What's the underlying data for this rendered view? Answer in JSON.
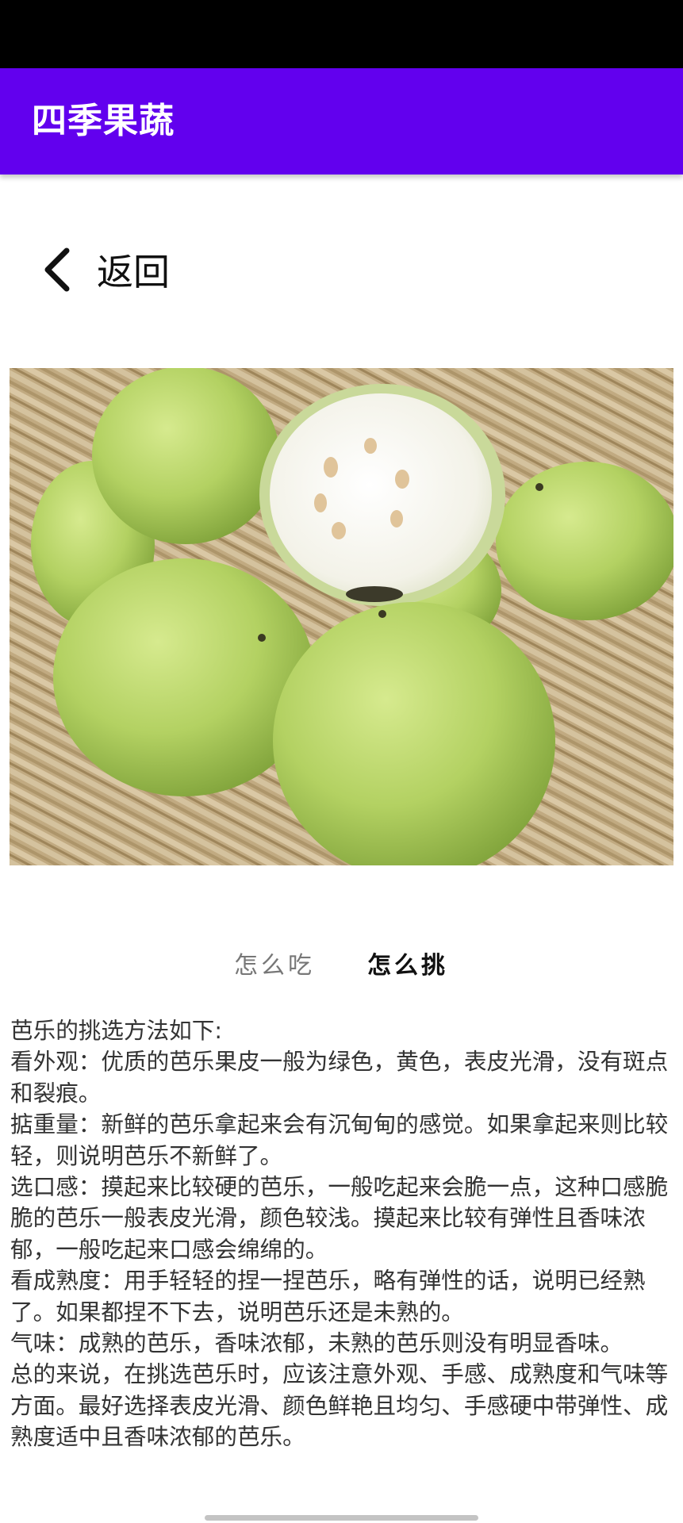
{
  "app": {
    "title": "四季果蔬"
  },
  "nav": {
    "back_label": "返回",
    "back_icon": "chevron-left-icon"
  },
  "hero_image": {
    "subject": "guava-basket-photo"
  },
  "tabs": [
    {
      "label": "怎么吃",
      "selected": false
    },
    {
      "label": "怎么挑",
      "selected": true
    }
  ],
  "content": {
    "paragraphs": [
      "芭乐的挑选方法如下:",
      "看外观：优质的芭乐果皮一般为绿色，黄色，表皮光滑，没有斑点和裂痕。",
      "掂重量：新鲜的芭乐拿起来会有沉甸甸的感觉。如果拿起来则比较轻，则说明芭乐不新鲜了。",
      "选口感：摸起来比较硬的芭乐，一般吃起来会脆一点，这种口感脆脆的芭乐一般表皮光滑，颜色较浅。摸起来比较有弹性且香味浓郁，一般吃起来口感会绵绵的。",
      "看成熟度：用手轻轻的捏一捏芭乐，略有弹性的话，说明已经熟了。如果都捏不下去，说明芭乐还是未熟的。",
      "气味：成熟的芭乐，香味浓郁，未熟的芭乐则没有明显香味。",
      "总的来说，在挑选芭乐时，应该注意外观、手感、成熟度和气味等方面。最好选择表皮光滑、颜色鲜艳且均匀、手感硬中带弹性、成熟度适中且香味浓郁的芭乐。"
    ]
  },
  "colors": {
    "status_bar": "#000000",
    "app_bar": "#6200ee",
    "title_text": "#ffffff",
    "selected_tab": "#111111",
    "unselected_tab": "#777777",
    "body_text": "#333333"
  }
}
